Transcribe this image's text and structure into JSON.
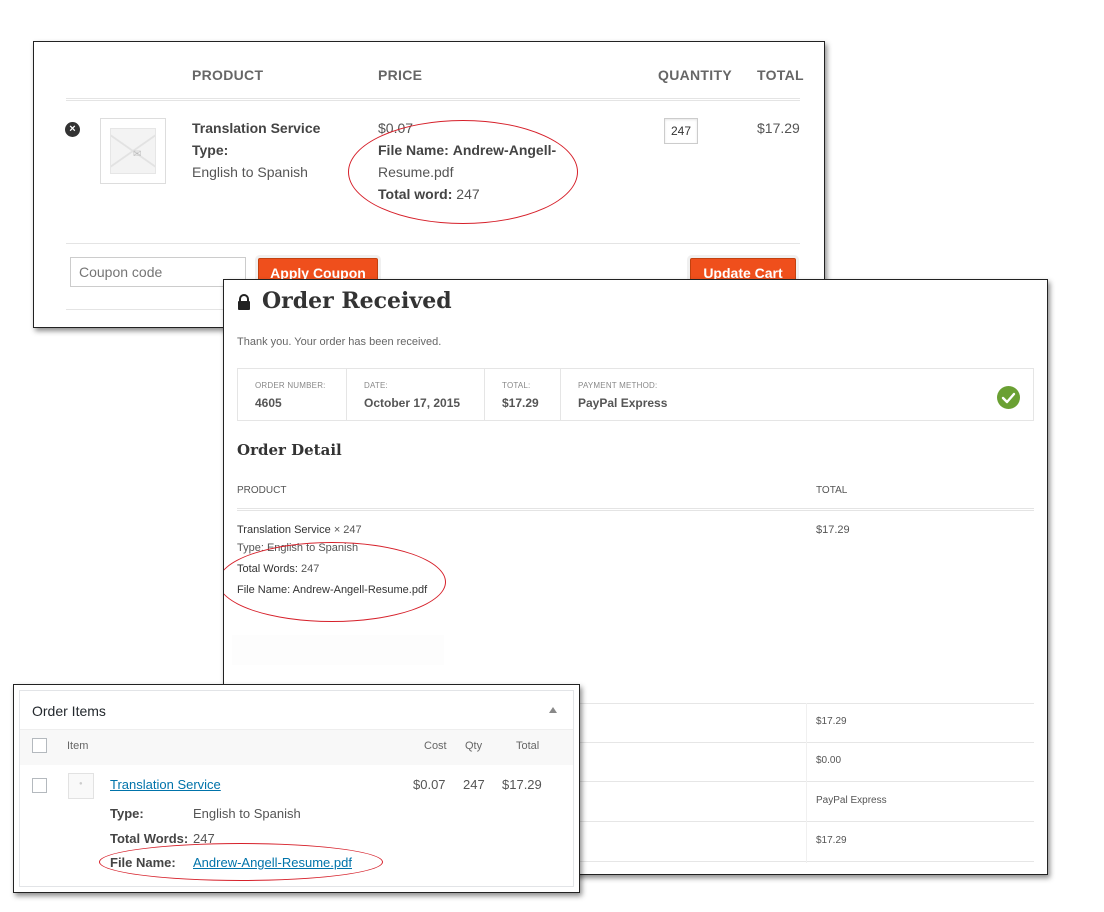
{
  "cart": {
    "headers": {
      "product": "PRODUCT",
      "price": "PRICE",
      "quantity": "QUANTITY",
      "total": "TOTAL"
    },
    "item": {
      "name": "Translation Service",
      "type_label": "Type:",
      "type_value": "English to Spanish",
      "price": "$0.07",
      "file_label": "File Name:",
      "file_value_1": "Andrew-Angell-",
      "file_value_2": "Resume.pdf",
      "words_label": "Total word:",
      "words_value": "247",
      "quantity": "247",
      "total": "$17.29"
    },
    "coupon_placeholder": "Coupon code",
    "apply_coupon_label": "Apply Coupon",
    "update_cart_label": "Update Cart"
  },
  "order": {
    "title": "Order Received",
    "thanks": "Thank you. Your order has been received.",
    "summary": {
      "order_number_label": "ORDER NUMBER:",
      "order_number": "4605",
      "date_label": "DATE:",
      "date": "October 17, 2015",
      "total_label": "TOTAL:",
      "total": "$17.29",
      "payment_label": "PAYMENT METHOD:",
      "payment": "PayPal Express"
    },
    "detail_title": "Order Detail",
    "detail_headers": {
      "product": "PRODUCT",
      "total": "TOTAL"
    },
    "line": {
      "name": "Translation Service",
      "qty": "× 247",
      "type_label": "Type:",
      "type_value": "English to Spanish",
      "words_label": "Total Words:",
      "words_value": "247",
      "file_label": "File Name:",
      "file_value": "Andrew-Angell-Resume.pdf",
      "total": "$17.29"
    },
    "footer_values": [
      "$17.29",
      "$0.00",
      "PayPal Express",
      "$17.29"
    ]
  },
  "order_items": {
    "title": "Order Items",
    "headers": {
      "item": "Item",
      "cost": "Cost",
      "qty": "Qty",
      "total": "Total"
    },
    "row": {
      "name": "Translation Service",
      "cost": "$0.07",
      "qty": "247",
      "total": "$17.29",
      "type_label": "Type:",
      "type_value": "English to Spanish",
      "words_label": "Total Words:",
      "words_value": "247",
      "file_label": "File Name:",
      "file_value": "Andrew-Angell-Resume.pdf"
    }
  },
  "colors": {
    "accent_orange": "#ef4f1c",
    "highlight_red": "#d6202a",
    "success_green": "#6aa033",
    "link_blue": "#0073aa"
  }
}
